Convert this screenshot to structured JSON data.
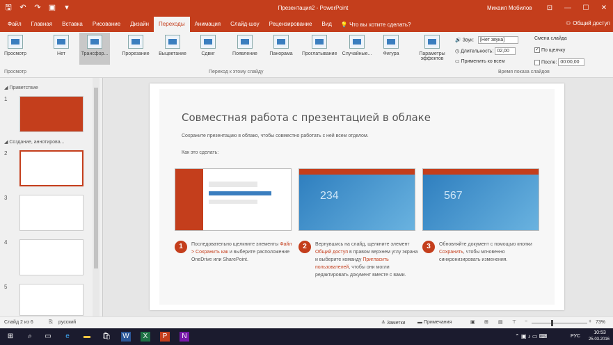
{
  "title_bar": {
    "title": "Презентация2 - PowerPoint",
    "user": "Михаил Мобилов",
    "minimize": "—",
    "maximize": "☐",
    "close": "✕"
  },
  "tabs": [
    "Файл",
    "Главная",
    "Вставка",
    "Рисование",
    "Дизайн",
    "Переходы",
    "Анимация",
    "Слайд-шоу",
    "Рецензирование",
    "Вид"
  ],
  "active_tab": "Переходы",
  "tell_me": "Что вы хотите сделать?",
  "share": "Общий доступ",
  "ribbon": {
    "preview": "Просмотр",
    "transitions": [
      "Нет",
      "Трансфор...",
      "Прорезание",
      "Выцветание",
      "Сдвиг",
      "Появление",
      "Панорама",
      "Проглатывание",
      "Случайные...",
      "Фигура"
    ],
    "effect_options": "Параметры эффектов",
    "group_preview": "Просмотр",
    "group_transitions": "Переход к этому слайду",
    "group_timing": "Время показа слайдов",
    "sound_label": "Звук:",
    "sound_value": "[Нет звука]",
    "duration_label": "Длительность:",
    "duration_value": "02,00",
    "apply_all": "Применить ко всем",
    "advance_label": "Смена слайда",
    "on_click": "По щелчку",
    "after_label": "После:",
    "after_value": "00:00,00"
  },
  "thumbnails": {
    "sections": [
      "Приветствие",
      "Создание, аннотирова..."
    ],
    "slide_numbers": [
      "1",
      "2",
      "3",
      "4",
      "5"
    ]
  },
  "slide": {
    "title": "Совместная работа с презентацией в облаке",
    "subtitle": "Сохраните презентацию в облако, чтобы совместно работать с ней всем отделом.",
    "how": "Как это сделать:",
    "shot_numbers": [
      "234",
      "567"
    ],
    "steps": [
      {
        "num": "1",
        "text_a": "Последовательно щелкните элементы ",
        "link_a": "Файл > Сохранить как",
        "text_b": " и выберите расположение OneDrive или SharePoint."
      },
      {
        "num": "2",
        "text_a": "Вернувшись на слайд, щелкните элемент ",
        "link_a": "Общий доступ",
        "text_b": " в правом верхнем углу экрана и выберите команду ",
        "link_b": "Пригласить пользователей",
        "text_c": ", чтобы они могли редактировать документ вместе с вами."
      },
      {
        "num": "3",
        "text_a": "Обновляйте документ с помощью кнопки ",
        "link_a": "Сохранить",
        "text_b": ", чтобы мгновенно синхронизировать изменения."
      }
    ]
  },
  "status": {
    "slide_info": "Слайд 2 из 6",
    "lang": "русский",
    "notes": "Заметки",
    "comments": "Примечания",
    "zoom": "73%"
  },
  "taskbar": {
    "lang": "РУС",
    "time": "10:53",
    "date": "25.03.2016"
  }
}
